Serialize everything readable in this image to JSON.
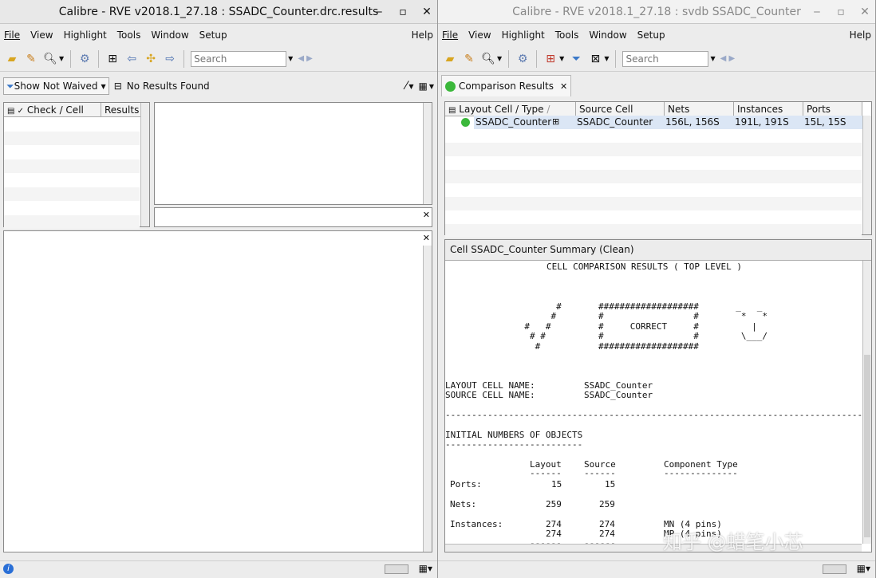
{
  "left": {
    "title": "Calibre - RVE v2018.1_27.18 : SSADC_Counter.drc.results",
    "menu": [
      "File",
      "View",
      "Highlight",
      "Tools",
      "Window",
      "Setup"
    ],
    "menu_help": "Help",
    "search_placeholder": "Search",
    "filter_label": "Show Not Waived",
    "results_label": "No Results Found",
    "tree_headers": [
      "Check / Cell",
      "Results"
    ]
  },
  "right": {
    "title": "Calibre - RVE v2018.1_27.18 : svdb SSADC_Counter",
    "menu": [
      "File",
      "View",
      "Highlight",
      "Tools",
      "Window",
      "Setup"
    ],
    "menu_help": "Help",
    "search_placeholder": "Search",
    "tab_label": "Comparison Results",
    "table_headers": [
      "Layout Cell / Type",
      "Source Cell",
      "Nets",
      "Instances",
      "Ports"
    ],
    "row": {
      "layout_cell": "SSADC_Counter",
      "source_cell": "SSADC_Counter",
      "nets": "156L, 156S",
      "instances": "191L, 191S",
      "ports": "15L, 15S"
    },
    "summary_title": "Cell SSADC_Counter Summary (Clean)",
    "report": {
      "heading": "CELL COMPARISON RESULTS ( TOP LEVEL )",
      "art": [
        "                     #       ###################       _   _",
        "                    #        #                 #        *   *",
        "               #   #         #     CORRECT     #          |",
        "                # #          #                 #        \\___/",
        "                 #           ###################"
      ],
      "layout_cell_label": "LAYOUT CELL NAME:",
      "layout_cell_value": "SSADC_Counter",
      "source_cell_label": "SOURCE CELL NAME:",
      "source_cell_value": "SSADC_Counter",
      "divider": "--------------------------------------------------------------------------------------",
      "section": "INITIAL NUMBERS OF OBJECTS",
      "section_underline": "--------------------------",
      "col_layout": "Layout",
      "col_source": "Source",
      "col_type": "Component Type",
      "col_layout_ul": "------",
      "col_source_ul": "------",
      "col_type_ul": "--------------",
      "ports_label": "Ports:",
      "ports_layout": "15",
      "ports_source": "15",
      "nets_label": "Nets:",
      "nets_layout": "259",
      "nets_source": "259",
      "inst_label": "Instances:",
      "inst_layout_1": "274",
      "inst_source_1": "274",
      "inst_type_1": "MN (4 pins)",
      "inst_layout_2": "274",
      "inst_source_2": "274",
      "inst_type_2": "MP (4 pins)",
      "tail_ul_1": "------",
      "tail_ul_2": "------"
    }
  },
  "watermark": "知乎 @蜡笔小芯",
  "colors": {
    "green_status": "#3bb83b",
    "selection": "#dbe6f5"
  }
}
